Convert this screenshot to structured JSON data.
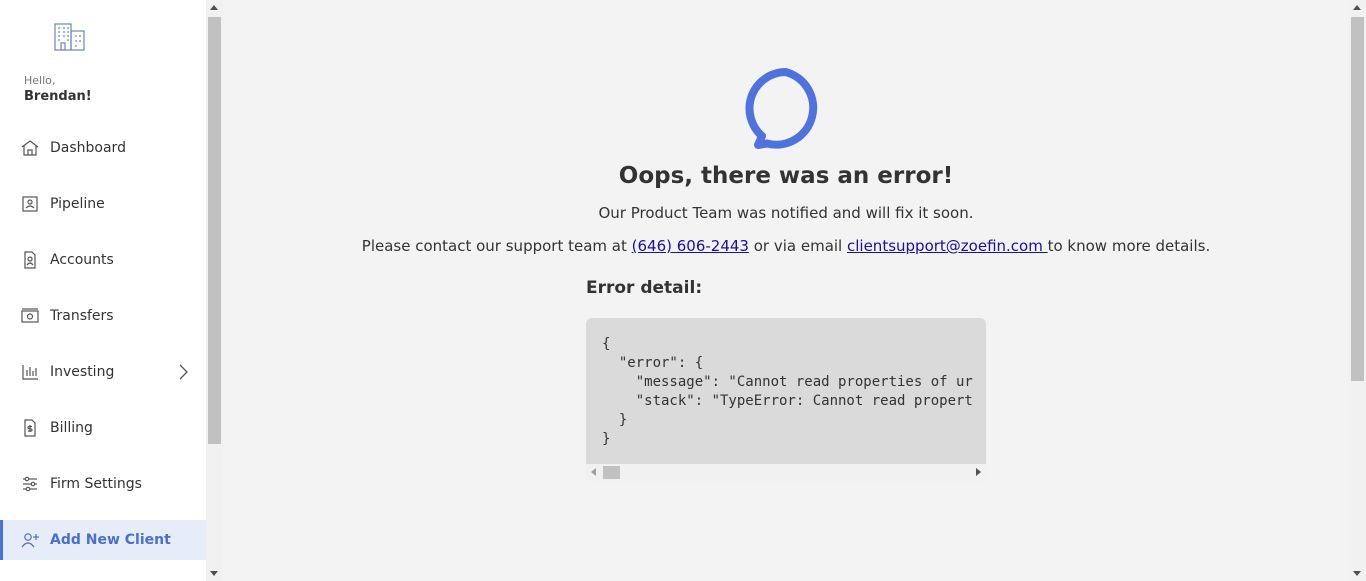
{
  "sidebar": {
    "greeting": "Hello,",
    "user_name": "Brendan!",
    "items": [
      {
        "label": "Dashboard",
        "icon": "home-icon"
      },
      {
        "label": "Pipeline",
        "icon": "id-card-icon"
      },
      {
        "label": "Accounts",
        "icon": "document-user-icon"
      },
      {
        "label": "Transfers",
        "icon": "money-icon"
      },
      {
        "label": "Investing",
        "icon": "chart-icon"
      },
      {
        "label": "Billing",
        "icon": "invoice-icon"
      },
      {
        "label": "Firm Settings",
        "icon": "sliders-icon"
      },
      {
        "label": "Add New Client",
        "icon": "add-user-icon",
        "active": true
      }
    ]
  },
  "error": {
    "title": "Oops, there was an error!",
    "subtitle": "Our Product Team was notified and will fix it soon.",
    "contact_prefix": "Please contact our support team at ",
    "phone": "(646) 606-2443",
    "contact_middle": " or via email ",
    "email": "clientsupport@zoefin.com ",
    "contact_suffix": "to know more details.",
    "detail_title": "Error detail:",
    "code_text": "{\n  \"error\": {\n    \"message\": \"Cannot read properties of ur\n    \"stack\": \"TypeError: Cannot read propert\n  }\n}"
  },
  "colors": {
    "accent": "#4a72d8",
    "active_bg": "#e6ecf8",
    "link": "#1a0dab",
    "background": "#f3f3f3"
  }
}
